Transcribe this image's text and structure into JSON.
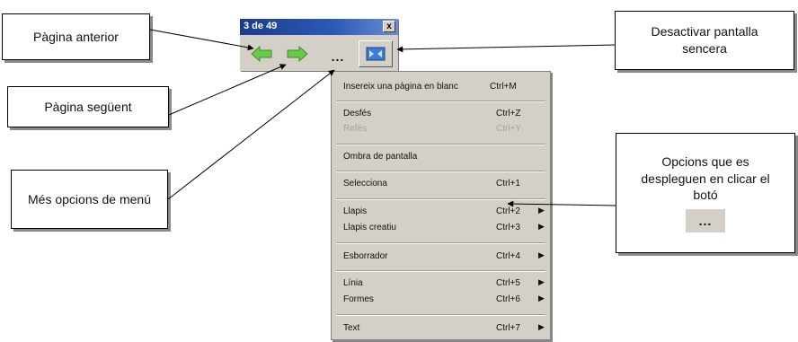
{
  "callouts": {
    "previous_page": "Pàgina anterior",
    "next_page": "Pàgina següent",
    "more_options": "Més opcions de menú",
    "fullscreen_off": "Desactivar pantalla sencera",
    "options_text": "Opcions que es despleguen en clicar el botó",
    "options_dots": "..."
  },
  "toolbar": {
    "title": "3 de 49",
    "close_label": "x",
    "more_label": "..."
  },
  "menu": {
    "items": [
      {
        "label": "Insereix una pàgina en blanc",
        "shortcut": "Ctrl+M",
        "submenu": false,
        "disabled": false
      },
      {
        "label": "Desfés",
        "shortcut": "Ctrl+Z",
        "submenu": false,
        "disabled": false
      },
      {
        "label": "Refés",
        "shortcut": "Ctrl+Y",
        "submenu": false,
        "disabled": true
      },
      {
        "label": "Ombra de pantalla",
        "shortcut": "",
        "submenu": false,
        "disabled": false
      },
      {
        "label": "Selecciona",
        "shortcut": "Ctrl+1",
        "submenu": false,
        "disabled": false
      },
      {
        "label": "Llapis",
        "shortcut": "Ctrl+2",
        "submenu": true,
        "disabled": false
      },
      {
        "label": "Llapis creatiu",
        "shortcut": "Ctrl+3",
        "submenu": true,
        "disabled": false
      },
      {
        "label": "Esborrador",
        "shortcut": "Ctrl+4",
        "submenu": true,
        "disabled": false
      },
      {
        "label": "Línia",
        "shortcut": "Ctrl+5",
        "submenu": true,
        "disabled": false
      },
      {
        "label": "Formes",
        "shortcut": "Ctrl+6",
        "submenu": true,
        "disabled": false
      },
      {
        "label": "Text",
        "shortcut": "Ctrl+7",
        "submenu": true,
        "disabled": false
      }
    ],
    "submenu_arrow": "▶"
  },
  "colors": {
    "titlebar": "#2a5ab8",
    "menu_bg": "#d4d0c8",
    "arrow_green": "#5cbf3a"
  },
  "icons": [
    "back-arrow-icon",
    "forward-arrow-icon",
    "fullscreen-icon",
    "close-icon"
  ]
}
